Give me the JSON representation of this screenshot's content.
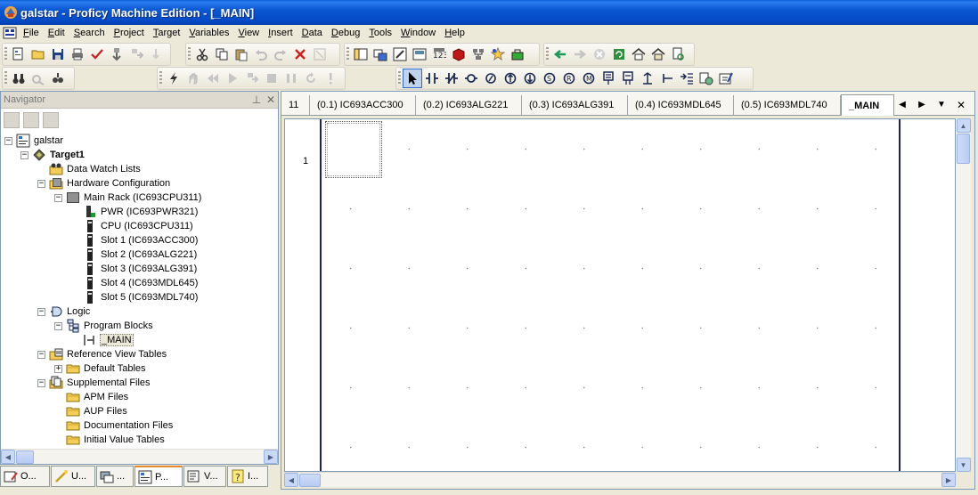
{
  "window": {
    "title": "galstar - Proficy Machine Edition - [_MAIN]"
  },
  "menubar": {
    "items": [
      "File",
      "Edit",
      "Search",
      "Project",
      "Target",
      "Variables",
      "View",
      "Insert",
      "Data",
      "Debug",
      "Tools",
      "Window",
      "Help"
    ]
  },
  "navigator": {
    "title": "Navigator",
    "pin_icon": "pin-icon",
    "close_icon": "close-icon",
    "tree": [
      {
        "label": "galstar",
        "expander": "−",
        "icon": "project-icon"
      },
      {
        "label": "Target1",
        "expander": "−",
        "icon": "target-icon",
        "bold": true
      },
      {
        "label": "Data Watch Lists",
        "icon": "watch-list-folder-icon"
      },
      {
        "label": "Hardware Configuration",
        "expander": "−",
        "icon": "hardware-config-icon"
      },
      {
        "label": "Main Rack (IC693CPU311)",
        "expander": "−",
        "icon": "rack-icon"
      },
      {
        "label": "PWR (IC693PWR321)",
        "icon": "power-supply-icon"
      },
      {
        "label": "CPU (IC693CPU311)",
        "icon": "module-icon"
      },
      {
        "label": "Slot 1 (IC693ACC300)",
        "icon": "module-icon"
      },
      {
        "label": "Slot 2 (IC693ALG221)",
        "icon": "module-icon"
      },
      {
        "label": "Slot 3 (IC693ALG391)",
        "icon": "module-icon"
      },
      {
        "label": "Slot 4 (IC693MDL645)",
        "icon": "module-icon"
      },
      {
        "label": "Slot 5 (IC693MDL740)",
        "icon": "module-icon"
      },
      {
        "label": "Logic",
        "expander": "−",
        "icon": "logic-icon"
      },
      {
        "label": "Program Blocks",
        "expander": "−",
        "icon": "program-blocks-icon"
      },
      {
        "label": "_MAIN",
        "icon": "ladder-block-icon",
        "selected": true
      },
      {
        "label": "Reference View Tables",
        "expander": "−",
        "icon": "reference-tables-icon"
      },
      {
        "label": "Default Tables",
        "expander": "+",
        "icon": "folder-icon"
      },
      {
        "label": "Supplemental Files",
        "expander": "−",
        "icon": "supplemental-files-icon"
      },
      {
        "label": "APM Files",
        "icon": "folder-icon"
      },
      {
        "label": "AUP Files",
        "icon": "folder-icon"
      },
      {
        "label": "Documentation Files",
        "icon": "folder-icon"
      },
      {
        "label": "Initial Value Tables",
        "icon": "folder-icon"
      }
    ],
    "bottom_tabs": [
      {
        "label": "O...",
        "icon": "options-icon"
      },
      {
        "label": "U...",
        "icon": "utilities-icon"
      },
      {
        "label": "...",
        "icon": "manager-icon"
      },
      {
        "label": "P...",
        "icon": "project-tab-icon",
        "active": true
      },
      {
        "label": "V...",
        "icon": "variables-tab-icon"
      },
      {
        "label": "I...",
        "icon": "info-tab-icon"
      }
    ]
  },
  "editor": {
    "tabs": [
      "11",
      "(0.1) IC693ACC300",
      "(0.2) IC693ALG221",
      "(0.3) IC693ALG391",
      "(0.4) IC693MDL645",
      "(0.5) IC693MDL740",
      "_MAIN"
    ],
    "active_tab": "_MAIN",
    "rung_number": "1"
  },
  "colors": {
    "title_bar": "#0a58d2",
    "power_rail": "#1f1c73",
    "menu_background": "#ece9d8"
  }
}
